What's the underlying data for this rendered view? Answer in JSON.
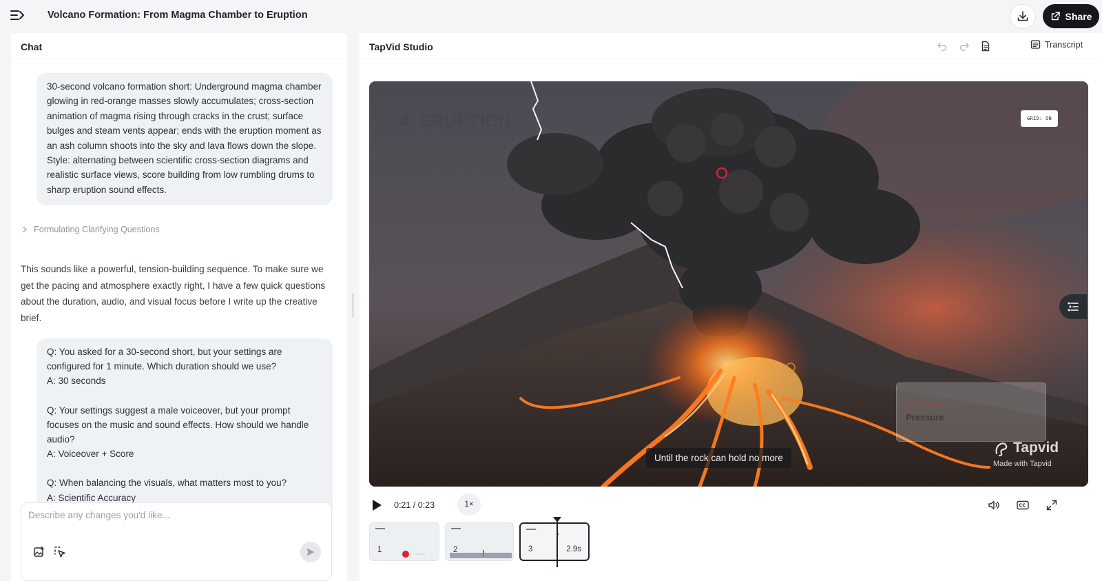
{
  "header": {
    "title": "Volcano Formation: From Magma Chamber to Eruption",
    "share_label": "Share",
    "icons": {
      "menu": "sidebar-toggle-icon",
      "download": "download-icon",
      "share": "share-icon"
    }
  },
  "chat": {
    "title": "Chat",
    "user_prompt": "30-second volcano formation short: Underground magma chamber glowing in red-orange masses slowly accumulates; cross-section animation of magma rising through cracks in the crust; surface bulges and steam vents appear; ends with the eruption moment as an ash column shoots into the sky and lava flows down the slope. Style: alternating between scientific cross-section diagrams and realistic surface views, score building from low rumbling drums to sharp eruption sound effects.",
    "thinking_label": "Formulating Clarifying Questions",
    "assistant_reply": "This sounds like a powerful, tension-building sequence. To make sure we get the pacing and atmosphere exactly right, I have a few quick questions about the duration, audio, and visual focus before I write up the creative brief.",
    "qa": [
      {
        "q": "Q: You asked for a 30-second short, but your settings are configured for 1 minute. Which duration should we use?",
        "a": "A: 30 seconds"
      },
      {
        "q": "Q: Your settings suggest a male voiceover, but your prompt focuses on the music and sound effects. How should we handle audio?",
        "a": "A: Voiceover + Score"
      },
      {
        "q": "Q: When balancing the visuals, what matters most to you?",
        "a": "A: Scientific Accuracy"
      }
    ],
    "composer_placeholder": "Describe any changes you'd like..."
  },
  "studio": {
    "title": "TapVid Studio",
    "transcript_label": "Transcript",
    "video": {
      "scene_title": "4. ERUPTION",
      "grid_badge": "GRID: ON",
      "takeaway_label": "KEY TAKEAWAY",
      "takeaway_word": "Pressure",
      "caption": "Until the rock can hold no more",
      "watermark_name": "Tapvid",
      "watermark_sub": "Made with Tapvid"
    },
    "controls": {
      "time": "0:21 / 0:23",
      "speed": "1×",
      "progress": 0.913
    },
    "clips": [
      {
        "num": "1",
        "dur": ""
      },
      {
        "num": "2",
        "dur": ""
      },
      {
        "num": "3",
        "dur": "2.9s"
      }
    ],
    "colors": {
      "accent": "#14181d",
      "lava": "#ff6a1a",
      "ash": "#2b2a2c"
    }
  }
}
